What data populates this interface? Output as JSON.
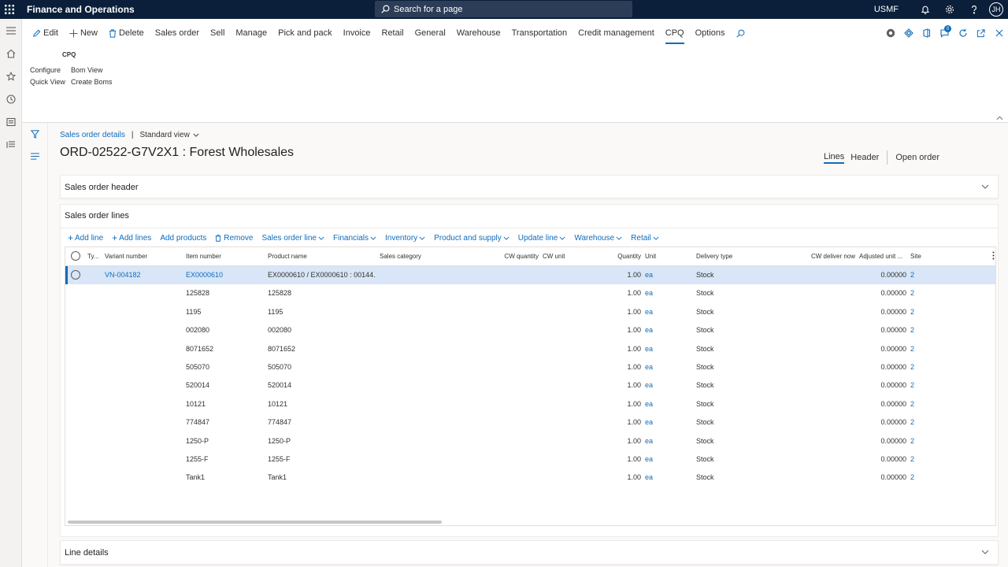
{
  "topbar": {
    "app_title": "Finance and Operations",
    "search_placeholder": "Search for a page",
    "company": "USMF",
    "avatar_initials": "JH",
    "bg_color": "#0b1f3a"
  },
  "ribbon": {
    "items": [
      {
        "label": "Edit",
        "icon": "edit-icon"
      },
      {
        "label": "New",
        "icon": "plus-icon"
      },
      {
        "label": "Delete",
        "icon": "trash-icon"
      },
      {
        "label": "Sales order"
      },
      {
        "label": "Sell"
      },
      {
        "label": "Manage"
      },
      {
        "label": "Pick and pack"
      },
      {
        "label": "Invoice"
      },
      {
        "label": "Retail"
      },
      {
        "label": "General"
      },
      {
        "label": "Warehouse"
      },
      {
        "label": "Transportation"
      },
      {
        "label": "Credit management"
      },
      {
        "label": "CPQ",
        "active": true
      },
      {
        "label": "Options"
      }
    ],
    "notification_count": "0",
    "cpq": {
      "group_label": "CPQ",
      "configure": "Configure",
      "quick_view": "Quick View",
      "bom_view": "Bom View",
      "create_boms": "Create Boms"
    }
  },
  "breadcrumb": {
    "link": "Sales order details",
    "view": "Standard view"
  },
  "page_title": "ORD-02522-G7V2X1 : Forest Wholesales",
  "view_tabs": {
    "lines": "Lines",
    "header": "Header",
    "open_order": "Open order"
  },
  "fasttabs": {
    "header": "Sales order header",
    "lines": "Sales order lines",
    "line_details": "Line details"
  },
  "grid_toolbar": [
    {
      "label": "Add line",
      "plus": true
    },
    {
      "label": "Add lines",
      "plus": true
    },
    {
      "label": "Add products"
    },
    {
      "label": "Remove",
      "trash": true
    },
    {
      "label": "Sales order line",
      "chevron": true
    },
    {
      "label": "Financials",
      "chevron": true
    },
    {
      "label": "Inventory",
      "chevron": true
    },
    {
      "label": "Product and supply",
      "chevron": true
    },
    {
      "label": "Update line",
      "chevron": true
    },
    {
      "label": "Warehouse",
      "chevron": true
    },
    {
      "label": "Retail",
      "chevron": true
    }
  ],
  "grid": {
    "columns": {
      "type": "Ty...",
      "variant": "Variant number",
      "item": "Item number",
      "product": "Product name",
      "category": "Sales category",
      "cw_qty": "CW quantity",
      "cw_unit": "CW unit",
      "qty": "Quantity",
      "unit": "Unit",
      "delivery": "Delivery type",
      "cw_deliver": "CW deliver now",
      "adj_unit": "Adjusted unit ...",
      "site": "Site"
    },
    "rows": [
      {
        "variant": "VN-004182",
        "item": "EX0000610",
        "product": "EX0000610 / EX0000610 : 00144...",
        "qty": "1.00",
        "unit": "ea",
        "delivery": "Stock",
        "adj": "0.00000",
        "site": "2",
        "selected": true
      },
      {
        "variant": "",
        "item": "125828",
        "product": "125828",
        "qty": "1.00",
        "unit": "ea",
        "delivery": "Stock",
        "adj": "0.00000",
        "site": "2"
      },
      {
        "variant": "",
        "item": "1195",
        "product": "1195",
        "qty": "1.00",
        "unit": "ea",
        "delivery": "Stock",
        "adj": "0.00000",
        "site": "2"
      },
      {
        "variant": "",
        "item": "002080",
        "product": "002080",
        "qty": "1.00",
        "unit": "ea",
        "delivery": "Stock",
        "adj": "0.00000",
        "site": "2"
      },
      {
        "variant": "",
        "item": "8071652",
        "product": "8071652",
        "qty": "1.00",
        "unit": "ea",
        "delivery": "Stock",
        "adj": "0.00000",
        "site": "2"
      },
      {
        "variant": "",
        "item": "505070",
        "product": "505070",
        "qty": "1.00",
        "unit": "ea",
        "delivery": "Stock",
        "adj": "0.00000",
        "site": "2"
      },
      {
        "variant": "",
        "item": "520014",
        "product": "520014",
        "qty": "1.00",
        "unit": "ea",
        "delivery": "Stock",
        "adj": "0.00000",
        "site": "2"
      },
      {
        "variant": "",
        "item": "10121",
        "product": "10121",
        "qty": "1.00",
        "unit": "ea",
        "delivery": "Stock",
        "adj": "0.00000",
        "site": "2"
      },
      {
        "variant": "",
        "item": "774847",
        "product": "774847",
        "qty": "1.00",
        "unit": "ea",
        "delivery": "Stock",
        "adj": "0.00000",
        "site": "2"
      },
      {
        "variant": "",
        "item": "1250-P",
        "product": "1250-P",
        "qty": "1.00",
        "unit": "ea",
        "delivery": "Stock",
        "adj": "0.00000",
        "site": "2"
      },
      {
        "variant": "",
        "item": "1255-F",
        "product": "1255-F",
        "qty": "1.00",
        "unit": "ea",
        "delivery": "Stock",
        "adj": "0.00000",
        "site": "2"
      },
      {
        "variant": "",
        "item": "Tank1",
        "product": "Tank1",
        "qty": "1.00",
        "unit": "ea",
        "delivery": "Stock",
        "adj": "0.00000",
        "site": "2"
      }
    ]
  },
  "colors": {
    "accent": "#0f6cbd",
    "selected_row": "#d8e6f7"
  }
}
